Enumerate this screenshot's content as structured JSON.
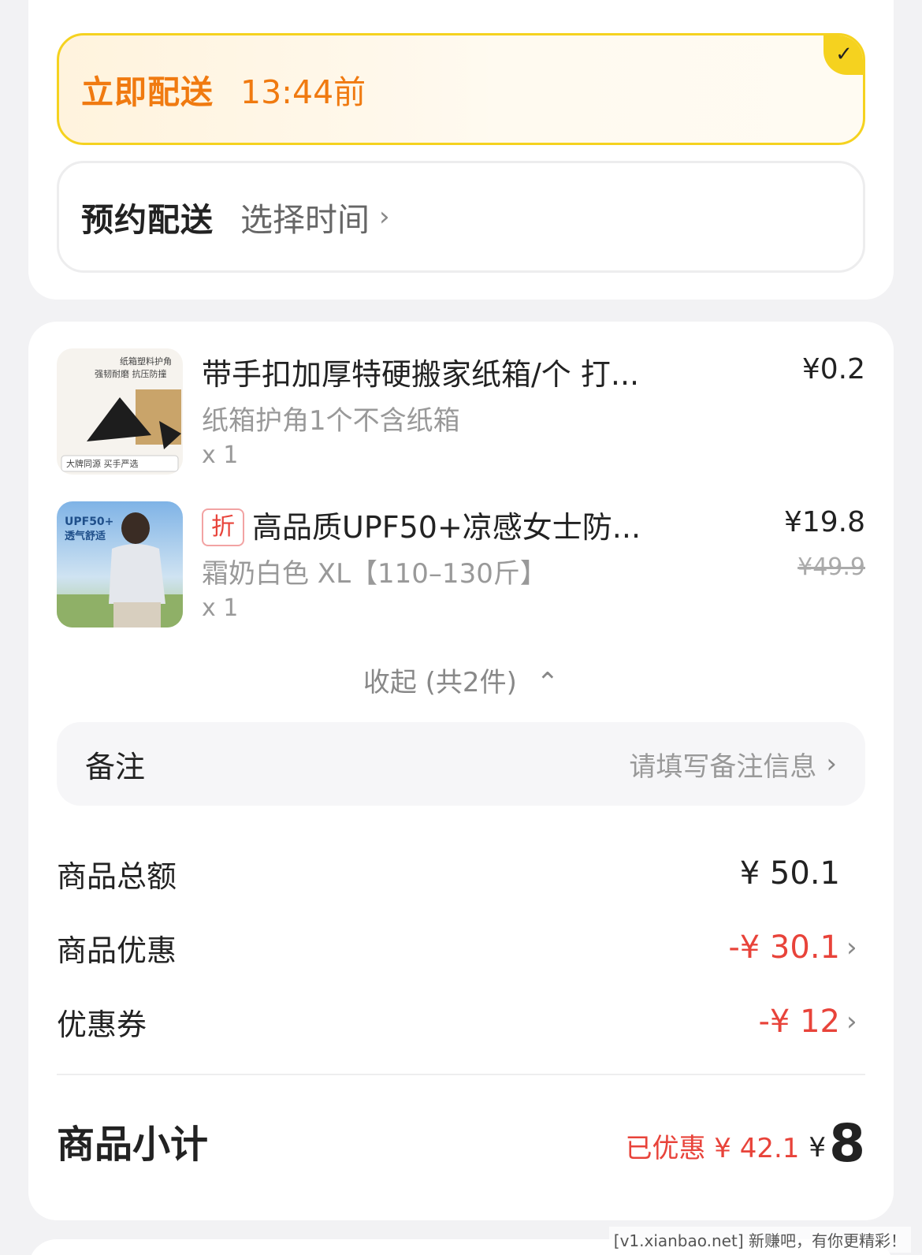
{
  "delivery": {
    "now_label": "立即配送",
    "now_time": "13:44前",
    "later_label": "预约配送",
    "later_action": "选择时间"
  },
  "items": [
    {
      "thumb_caption_top": "纸箱塑料护角",
      "thumb_caption_mid": "强韧耐磨 抗压防撞",
      "thumb_caption_bottom": "大牌同源 买手严选",
      "title": "带手扣加厚特硬搬家纸箱/个 打...",
      "spec": "纸箱护角1个不含纸箱",
      "qty": "x 1",
      "price": "¥0.2"
    },
    {
      "tag": "折",
      "thumb_caption_top": "UPF50+",
      "thumb_caption_mid": "透气舒适",
      "title": "高品质UPF50+凉感女士防...",
      "spec": "霜奶白色 XL【110–130斤】",
      "qty": "x 1",
      "price": "¥19.8",
      "orig_price": "¥49.9"
    }
  ],
  "collapse_label": "收起 (共2件)",
  "remark": {
    "label": "备注",
    "placeholder": "请填写备注信息"
  },
  "summary": {
    "total_label": "商品总额",
    "total_value": "¥ 50.1",
    "discount_label": "商品优惠",
    "discount_value": "-¥ 30.1",
    "coupon_label": "优惠券",
    "coupon_value": "-¥ 12",
    "subtotal_label": "商品小计",
    "saved_text": "已优惠 ¥ 42.1",
    "subtotal_currency": "¥",
    "subtotal_amount": "8"
  },
  "watermark": "[v1.xianbao.net] 新赚吧，有你更精彩！",
  "colors": {
    "accent_orange": "#f07a10",
    "accent_yellow": "#f5d21f",
    "price_red": "#e8433a"
  }
}
